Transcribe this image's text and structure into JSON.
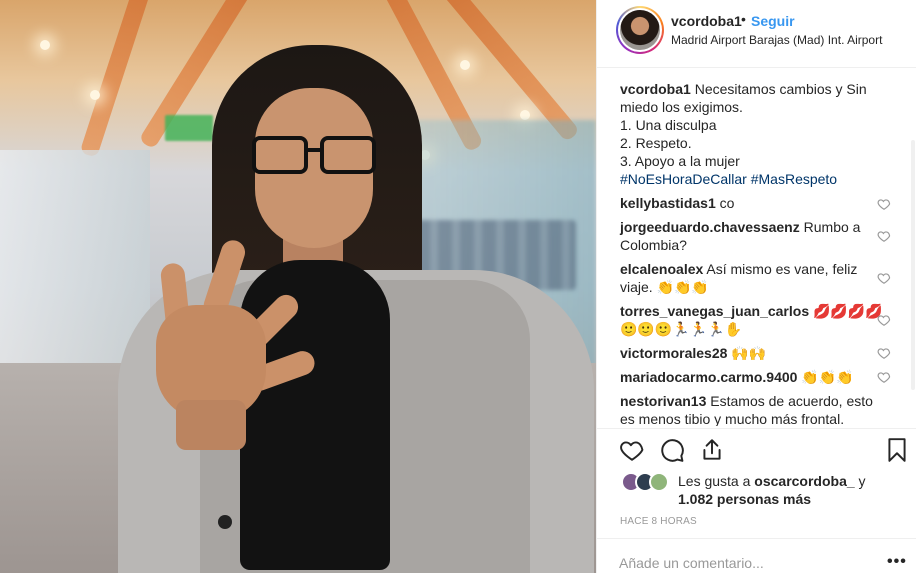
{
  "post": {
    "username": "vcordoba1",
    "separator": "•",
    "follow_label": "Seguir",
    "location": "Madrid Airport Barajas (Mad) Int. Airport"
  },
  "caption": {
    "username": "vcordoba1",
    "line1": "Necesitamos cambios y Sin miedo los exigimos.",
    "line2": "1. Una disculpa",
    "line3": "2. Respeto.",
    "line4": "3. Apoyo a la mujer",
    "hashtag1": "#NoEsHoraDeCallar",
    "hashtag2": "#MasRespeto"
  },
  "comments": [
    {
      "username": "kellybastidas1",
      "text": "co"
    },
    {
      "username": "jorgeeduardo.chavessaenz",
      "text": "Rumbo a Colombia?"
    },
    {
      "username": "elcalenoalex",
      "text": "Así mismo es vane, feliz viaje. 👏👏👏"
    },
    {
      "username": "torres_vanegas_juan_carlos",
      "text": "💋💋💋💋🙂🙂🙂🏃🏃🏃✋"
    },
    {
      "username": "victormorales28",
      "text": "🙌🙌"
    },
    {
      "username": "mariadocarmo.carmo.9400",
      "text": "👏👏👏"
    },
    {
      "username": "nestorivan13",
      "text": "Estamos de acuerdo, esto es menos tibio y mucho más frontal."
    }
  ],
  "likes": {
    "prefix": "Les gusta a",
    "user": "oscarcordoba_",
    "conj": "y",
    "count": "1.082 personas más"
  },
  "timestamp": "HACE 8 HORAS",
  "add_comment": {
    "placeholder": "Añade un comentario...",
    "more_label": "•••"
  },
  "colors": {
    "follow": "#3897f0",
    "hashtag": "#003569",
    "text": "#262626",
    "muted": "#999999"
  },
  "icons": {
    "like": "heart-icon",
    "comment": "comment-icon",
    "share": "share-icon",
    "save": "bookmark-icon",
    "comment_like": "small-heart-icon"
  }
}
